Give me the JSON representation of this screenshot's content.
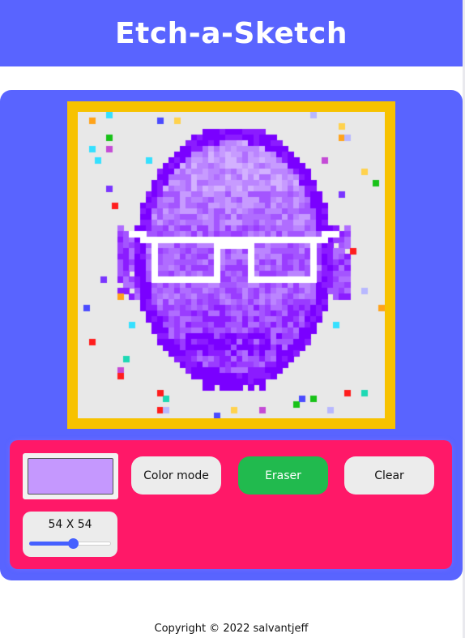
{
  "header": {
    "title": "Etch-a-Sketch"
  },
  "colors": {
    "header_bg": "#5964ff",
    "panel_bg": "#5964ff",
    "frame": "#f7c200",
    "board_bg": "#e8e8e8",
    "controls_bg": "#ff1868",
    "swatch": "#c598fe",
    "eraser_active": "#21ba4e",
    "slider_accent": "#4660ff"
  },
  "controls": {
    "current_color": "#c598fe",
    "color_mode_label": "Color mode",
    "eraser_label": "Eraser",
    "clear_label": "Clear",
    "active_mode": "eraser",
    "grid_size_label": "54 X 54",
    "grid_size_value": 54,
    "grid_size_min": 1,
    "grid_size_max": 100
  },
  "board": {
    "columns": 54,
    "rows": 54
  },
  "footer": {
    "text": "Copyright © 2022 salvantjeff"
  }
}
